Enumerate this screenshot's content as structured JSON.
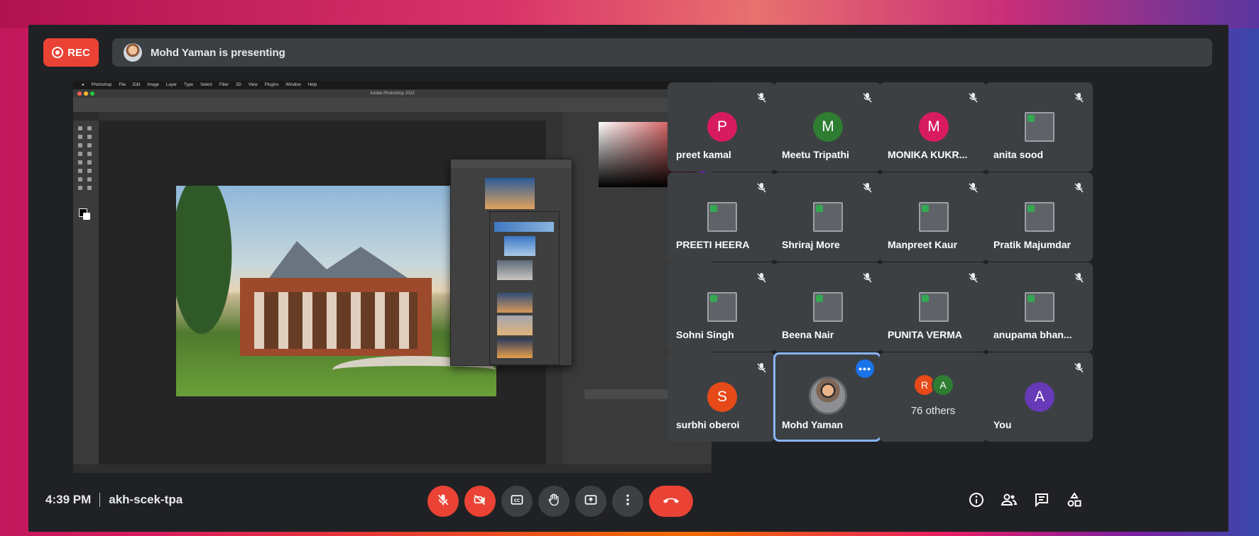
{
  "top": {
    "rec_label": "REC",
    "presenting_text": "Mohd Yaman is presenting"
  },
  "presentation": {
    "app": "Photoshop",
    "menu": [
      "Photoshop",
      "File",
      "Edit",
      "Image",
      "Layer",
      "Type",
      "Select",
      "Filter",
      "3D",
      "View",
      "Plugins",
      "Window",
      "Help"
    ],
    "window_title": "Adobe Photoshop 2022"
  },
  "participants": [
    {
      "name": "preet kamal",
      "initial": "P",
      "color": "#d81b60",
      "kind": "initial",
      "muted": true
    },
    {
      "name": "Meetu Tripathi",
      "initial": "M",
      "color": "#2e7d32",
      "kind": "initial",
      "muted": true
    },
    {
      "name": "MONIKA KUKR...",
      "initial": "M",
      "color": "#d81b60",
      "kind": "initial",
      "muted": true
    },
    {
      "name": "anita sood",
      "kind": "image",
      "muted": true
    },
    {
      "name": "PREETI HEERA",
      "kind": "image",
      "muted": true
    },
    {
      "name": "Shriraj More",
      "kind": "image",
      "muted": true
    },
    {
      "name": "Manpreet Kaur",
      "kind": "image",
      "muted": true
    },
    {
      "name": "Pratik Majumdar",
      "kind": "image",
      "muted": true
    },
    {
      "name": "Sohni Singh",
      "kind": "image",
      "muted": true
    },
    {
      "name": "Beena Nair",
      "kind": "image",
      "muted": true
    },
    {
      "name": "PUNITA VERMA",
      "kind": "image",
      "muted": true
    },
    {
      "name": "anupama bhan...",
      "kind": "image",
      "muted": true
    },
    {
      "name": "surbhi oberoi",
      "initial": "S",
      "color": "#e64a19",
      "kind": "initial",
      "muted": true
    },
    {
      "name": "Mohd Yaman",
      "kind": "photo",
      "muted": false,
      "active": true
    },
    {
      "name": "76 others",
      "kind": "others",
      "others": [
        {
          "initial": "R",
          "color": "#e64a19"
        },
        {
          "initial": "A",
          "color": "#2e7d32"
        }
      ]
    },
    {
      "name": "You",
      "initial": "A",
      "color": "#673ab7",
      "kind": "initial",
      "muted": true
    }
  ],
  "bottom": {
    "time": "4:39 PM",
    "meeting_code": "akh-scek-tpa"
  },
  "icons": {
    "mic": "mic-off-icon",
    "cam": "camera-off-icon",
    "captions": "captions-icon",
    "hand": "raise-hand-icon",
    "present": "present-icon",
    "more": "more-options-icon",
    "leave": "hang-up-icon",
    "info": "info-icon",
    "people": "people-icon",
    "chat": "chat-icon",
    "activities": "activities-icon"
  }
}
